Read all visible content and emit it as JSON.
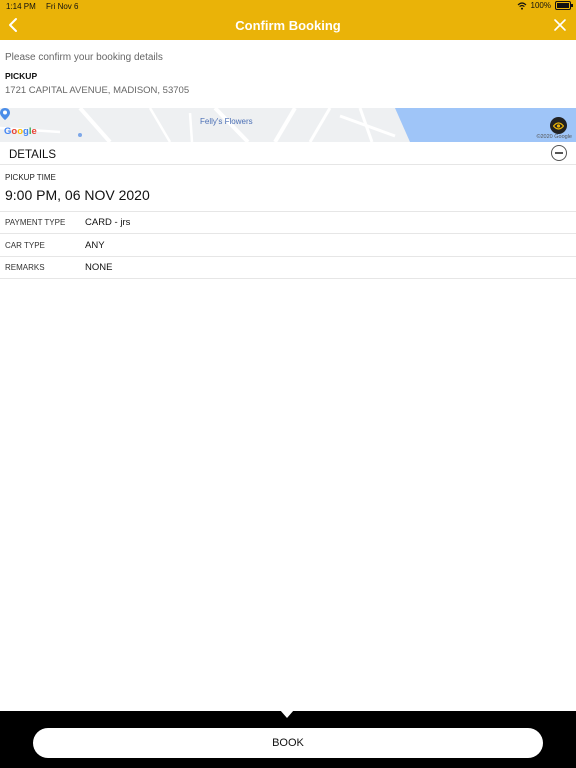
{
  "status_bar": {
    "time": "1:14 PM",
    "date": "Fri Nov 6",
    "battery": "100%"
  },
  "nav": {
    "title": "Confirm Booking"
  },
  "intro": {
    "text": "Please confirm your booking details"
  },
  "pickup": {
    "label": "PICKUP",
    "address": "1721 CAPITAL AVENUE, MADISON, 53705"
  },
  "map": {
    "poi": "Felly's Flowers",
    "logo": [
      "G",
      "o",
      "o",
      "g",
      "l",
      "e"
    ],
    "copyright": "©2020 Google"
  },
  "details": {
    "title": "DETAILS",
    "pickup_time_label": "PICKUP TIME",
    "pickup_time_value": "9:00 PM, 06 NOV 2020",
    "rows": [
      {
        "label": "PAYMENT TYPE",
        "value": "CARD - jrs"
      },
      {
        "label": "CAR TYPE",
        "value": "ANY"
      },
      {
        "label": "REMARKS",
        "value": "NONE"
      }
    ]
  },
  "footer": {
    "book_label": "BOOK"
  },
  "colors": {
    "header": "#eab308",
    "footer": "#000000",
    "water": "#9fc5f8"
  },
  "icons": [
    "back-icon",
    "close-icon",
    "wifi-icon",
    "battery-icon",
    "map-pin-icon",
    "eye-icon",
    "collapse-icon"
  ]
}
